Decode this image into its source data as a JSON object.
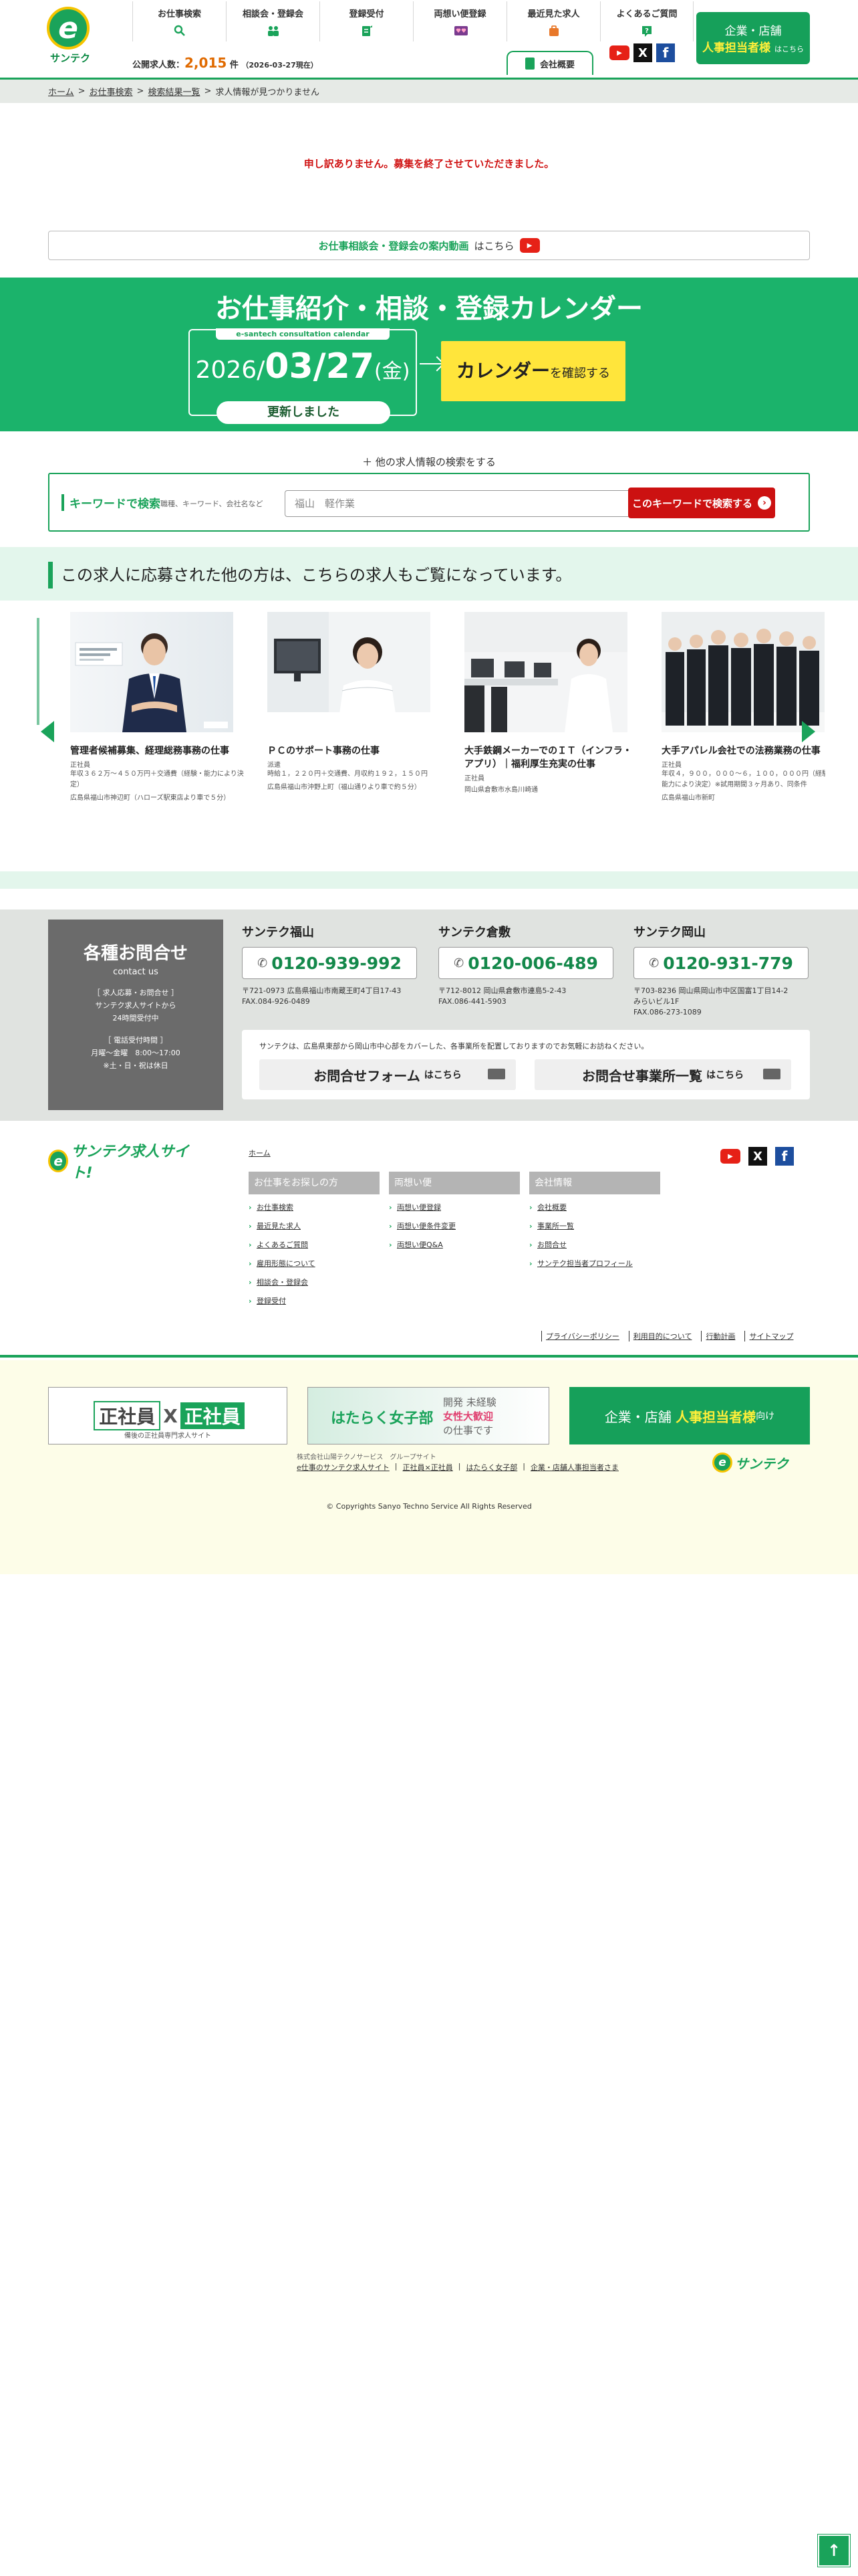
{
  "header": {
    "logo_text": "サンテク",
    "nav": [
      {
        "label": "お仕事検索",
        "icon": "search-icon"
      },
      {
        "label": "相談会・登録会",
        "icon": "people-icon"
      },
      {
        "label": "登録受付",
        "icon": "form-icon"
      },
      {
        "label": "両想い便登録",
        "icon": "hearts-icon"
      },
      {
        "label": "最近見た求人",
        "icon": "bag-icon"
      },
      {
        "label": "よくあるご質問",
        "icon": "question-icon"
      }
    ],
    "corp_button": {
      "line1": "企業・店舗",
      "line2": "人事担当者様",
      "line3": "はこちら"
    },
    "job_count": {
      "label": "公開求人数：",
      "value": "2,015",
      "unit": "件",
      "date": "（2026-03-27現在）"
    },
    "company_tab": "会社概要",
    "sns": {
      "youtube": "▶",
      "x": "X",
      "facebook": "f"
    }
  },
  "breadcrumb": [
    {
      "label": "ホーム",
      "link": true
    },
    {
      "label": "お仕事検索",
      "link": true
    },
    {
      "label": "検索結果一覧",
      "link": true
    },
    {
      "label": "求人情報が見つかりません",
      "link": false
    }
  ],
  "ended_message": "申し訳ありません。募集を終了させていただきました。",
  "video_banner": {
    "text": "お仕事相談会・登録会の案内動画",
    "suffix": "はこちら"
  },
  "calendar": {
    "title": "お仕事紹介・相談・登録カレンダー",
    "label": "e-santech consultation calendar",
    "year": "2026/",
    "month_day": "03/27",
    "weekday": "(金)",
    "updated": "更新しました",
    "button": "カレンダー",
    "button_suffix": "を確認する"
  },
  "search": {
    "other_link": "＋ 他の求人情報の検索をする",
    "keyword_label": "キーワードで検索",
    "keyword_hint": "職種、キーワード、会社名など",
    "placeholder": "福山　軽作業",
    "submit": "このキーワードで検索する"
  },
  "recommend": {
    "heading": "この求人に応募された他の方は、こちらの求人もご覧になっています。",
    "cards": [
      {
        "title": "管理者候補募集、経理総務事務の仕事",
        "type": "正社員",
        "salary": "年収３６２万〜４５０万円＋交通費（経験・能力により決定）",
        "location": "広島県福山市神辺町（ハローズ駅東店より車で５分）"
      },
      {
        "title": "ＰＣのサポート事務の仕事",
        "type": "派遣",
        "salary": "時給１，２２０円＋交通費、月収約１９２，１５０円",
        "location": "広島県福山市沖野上町（福山通りより車で約５分）"
      },
      {
        "title": "大手鉄鋼メーカーでのＩＴ（インフラ・アプリ）｜福利厚生充実の仕事",
        "type": "正社員",
        "salary": "",
        "location": "岡山県倉敷市水島川崎通"
      },
      {
        "title": "大手アパレル会社での法務業務の仕事",
        "type": "正社員",
        "salary": "年収４，９００，０００〜６，１００，０００円（経験・能力により決定）※試用期間３ヶ月あり、同条件",
        "location": "広島県福山市新町"
      }
    ]
  },
  "contact": {
    "title": "各種お問合せ",
    "subtitle": "contact us",
    "lines1": [
      "［ 求人応募・お問合せ ］",
      "サンテク求人サイトから",
      "24時間受付中"
    ],
    "lines2": [
      "［ 電話受付時間 ］",
      "月曜〜金曜　8:00〜17:00",
      "※土・日・祝は休日"
    ],
    "offices": [
      {
        "name": "サンテク福山",
        "tel": "0120-939-992",
        "addr": "〒721-0973 広島県福山市南蔵王町4丁目17-43",
        "fax": "FAX.084-926-0489"
      },
      {
        "name": "サンテク倉敷",
        "tel": "0120-006-489",
        "addr": "〒712-8012 岡山県倉敷市連島5-2-43",
        "fax": "FAX.086-441-5903"
      },
      {
        "name": "サンテク岡山",
        "tel": "0120-931-779",
        "addr": "〒703-8236 岡山県岡山市中区国富1丁目14-2",
        "addr2": "みらいビル1F",
        "fax": "FAX.086-273-1089"
      }
    ],
    "note": "サンテクは、広島県東部から岡山市中心部をカバーした、各事業所を配置しておりますのでお気軽にお訪ねください。",
    "form_button": "お問合せフォーム",
    "office_button": "お問合せ事業所一覧",
    "button_suffix": "はこちら"
  },
  "footer": {
    "logo_text": "サンテク求人サイト!",
    "home": "ホーム",
    "columns": [
      {
        "heading": "お仕事をお探しの方",
        "items": [
          "お仕事検索",
          "最近見た求人",
          "よくあるご質問",
          "雇用形態について",
          "相談会・登録会",
          "登録受付"
        ]
      },
      {
        "heading": "両想い便",
        "items": [
          "両想い便登録",
          "両想い便条件変更",
          "両想い便Q&A"
        ]
      },
      {
        "heading": "会社情報",
        "items": [
          "会社概要",
          "事業所一覧",
          "お問合せ",
          "サンテク担当者プロフィール"
        ]
      }
    ],
    "links": [
      "プライバシーポリシー",
      "利用目的について",
      "行動計画",
      "サイトマップ"
    ],
    "banners": {
      "seishain_a": "正社員",
      "seishain_x": "X",
      "seishain_b": "正社員",
      "seishain_sub": "備後の正社員専門求人サイト",
      "joshibu_logo": "はたらく女子部",
      "joshibu_l1": "開発 未経験",
      "joshibu_l2": "女性大歓迎",
      "joshibu_l3": "の仕事です",
      "corp_l1": "企業・店舗",
      "corp_l2": "人事担当者様",
      "corp_l3": "向け"
    },
    "group_label": "株式会社山陽テクノサービス　グループサイト",
    "group_links": [
      "e仕事のサンテク求人サイト",
      "正社員×正社員",
      "はたらく女子部",
      "企業・店舗人事担当者さま"
    ],
    "logo2_text": "サンテク",
    "copyright": "© Copyrights Sanyo Techno Service All Rights Reserved"
  },
  "page_top": "↑",
  "colors": {
    "brand_green": "#1aa35a",
    "alert_red": "#d01414",
    "accent_yellow": "#ffe53b",
    "button_red": "#cc1111"
  }
}
